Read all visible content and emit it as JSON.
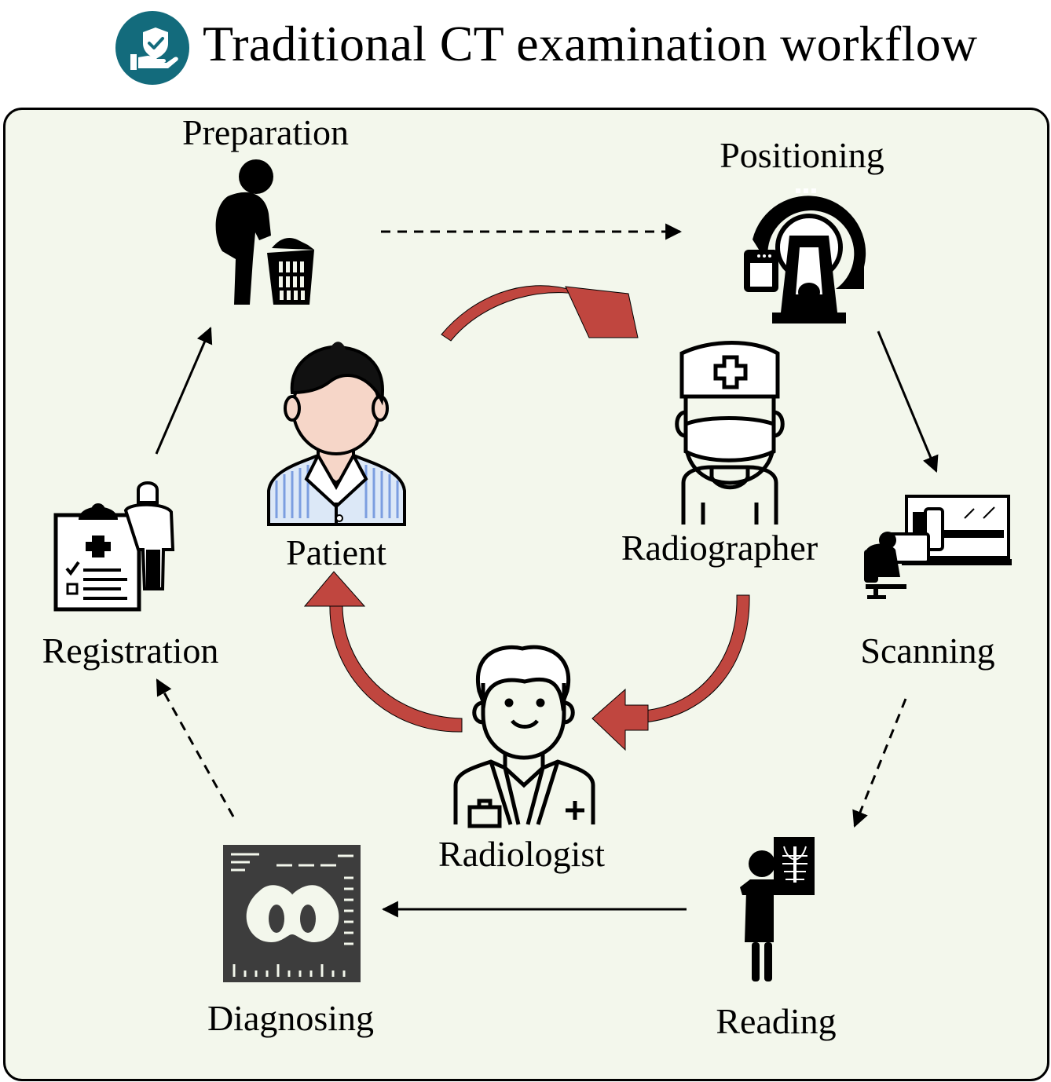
{
  "title": "Traditional CT examination workflow",
  "icons": {
    "logo": "shield-hand-check-icon",
    "preparation": "person-changing-clothes-icon",
    "positioning": "ct-scanner-icon",
    "scanning": "operator-console-icon",
    "reading": "doctor-reading-xray-icon",
    "diagnosing": "ct-scan-image-icon",
    "registration": "clipboard-person-icon",
    "patient": "patient-avatar-icon",
    "radiographer": "radiographer-avatar-icon",
    "radiologist": "radiologist-avatar-icon"
  },
  "colors": {
    "panel_bg": "#f3f7ec",
    "logo_bg": "#136b7c",
    "cycle_arrow": "#c0463f",
    "patient_skin": "#f6d6c8",
    "patient_gown": "#dce8f7",
    "patient_gown_stripes": "#7c9ee0"
  },
  "steps": {
    "preparation": "Preparation",
    "positioning": "Positioning",
    "scanning": "Scanning",
    "reading": "Reading",
    "diagnosing": "Diagnosing",
    "registration": "Registration"
  },
  "roles": {
    "patient": "Patient",
    "radiographer": "Radiographer",
    "radiologist": "Radiologist"
  },
  "flows": [
    {
      "from": "Preparation",
      "to": "Positioning",
      "style": "dashed"
    },
    {
      "from": "Positioning",
      "to": "Scanning",
      "style": "solid"
    },
    {
      "from": "Scanning",
      "to": "Reading",
      "style": "dashed"
    },
    {
      "from": "Reading",
      "to": "Diagnosing",
      "style": "solid"
    },
    {
      "from": "Diagnosing",
      "to": "Registration",
      "style": "dashed"
    },
    {
      "from": "Registration",
      "to": "Preparation",
      "style": "solid"
    },
    {
      "from": "Patient",
      "to": "Radiographer",
      "style": "cycle"
    },
    {
      "from": "Radiographer",
      "to": "Radiologist",
      "style": "cycle"
    },
    {
      "from": "Radiologist",
      "to": "Patient",
      "style": "cycle"
    }
  ]
}
